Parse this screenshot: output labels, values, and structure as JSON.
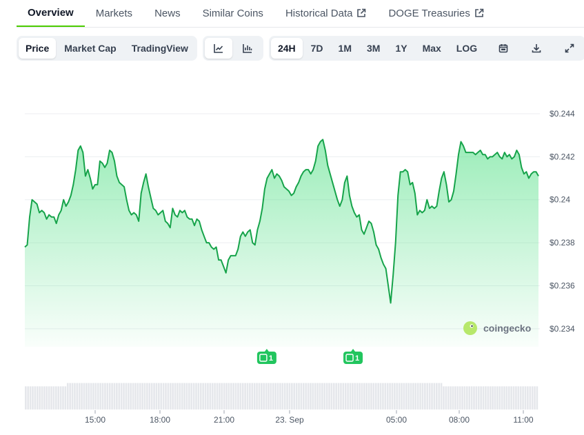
{
  "tabs": [
    {
      "label": "Overview",
      "active": true,
      "external": false
    },
    {
      "label": "Markets",
      "active": false,
      "external": false
    },
    {
      "label": "News",
      "active": false,
      "external": false
    },
    {
      "label": "Similar Coins",
      "active": false,
      "external": false
    },
    {
      "label": "Historical Data",
      "active": false,
      "external": true
    },
    {
      "label": "DOGE Treasuries",
      "active": false,
      "external": true
    }
  ],
  "toolbar": {
    "metric_buttons": [
      {
        "label": "Price",
        "selected": true
      },
      {
        "label": "Market Cap",
        "selected": false
      },
      {
        "label": "TradingView",
        "selected": false
      }
    ],
    "chart_type_icons": [
      {
        "icon": "line-chart-icon",
        "selected": true
      },
      {
        "icon": "candlestick-chart-icon",
        "selected": false
      }
    ],
    "range_buttons": [
      {
        "label": "24H",
        "selected": true
      },
      {
        "label": "7D",
        "selected": false
      },
      {
        "label": "1M",
        "selected": false
      },
      {
        "label": "3M",
        "selected": false
      },
      {
        "label": "1Y",
        "selected": false
      },
      {
        "label": "Max",
        "selected": false
      },
      {
        "label": "LOG",
        "selected": false
      }
    ],
    "action_icons": [
      "calendar-icon",
      "download-icon",
      "fullscreen-icon"
    ]
  },
  "watermark": "coingecko",
  "colors": {
    "line": "#16a34a",
    "area": "#4ade80",
    "accent": "#4bcc00",
    "volume": "#e5e7eb",
    "event": "#22c55e"
  },
  "chart_data": {
    "type": "area",
    "series": [
      {
        "values": [
          0.2378,
          0.2379,
          0.2392,
          0.24,
          0.2399,
          0.2398,
          0.2394,
          0.2395,
          0.2394,
          0.2391,
          0.2393,
          0.2392,
          0.2392,
          0.2389,
          0.2393,
          0.2395,
          0.24,
          0.2397,
          0.2399,
          0.2402,
          0.2407,
          0.2414,
          0.2423,
          0.2425,
          0.2422,
          0.2411,
          0.2414,
          0.241,
          0.2405,
          0.2407,
          0.2407,
          0.2418,
          0.2417,
          0.2415,
          0.2417,
          0.2423,
          0.2422,
          0.2418,
          0.2411,
          0.2408,
          0.2407,
          0.2406,
          0.24,
          0.2395,
          0.2393,
          0.2394,
          0.2393,
          0.239,
          0.2403,
          0.2408,
          0.2412,
          0.2406,
          0.2401,
          0.2396,
          0.2395,
          0.2393,
          0.2394,
          0.2395,
          0.239,
          0.2389,
          0.2387,
          0.2396,
          0.2393,
          0.2392,
          0.2395,
          0.2394,
          0.2395,
          0.2392,
          0.2391,
          0.2391,
          0.2388,
          0.2391,
          0.239,
          0.2386,
          0.2383,
          0.238,
          0.238,
          0.2378,
          0.2377,
          0.2378,
          0.2372,
          0.2372,
          0.2369,
          0.2366,
          0.2372,
          0.2374,
          0.2374,
          0.2374,
          0.2377,
          0.2383,
          0.2385,
          0.2383,
          0.2385,
          0.2386,
          0.238,
          0.2379,
          0.2386,
          0.239,
          0.2396,
          0.2405,
          0.241,
          0.2412,
          0.2414,
          0.241,
          0.2412,
          0.2411,
          0.2409,
          0.2406,
          0.2405,
          0.2404,
          0.2402,
          0.2403,
          0.2406,
          0.2408,
          0.2411,
          0.2413,
          0.2414,
          0.2414,
          0.2412,
          0.2414,
          0.2418,
          0.2425,
          0.2427,
          0.2428,
          0.2423,
          0.2416,
          0.2412,
          0.2408,
          0.2404,
          0.24,
          0.2397,
          0.24,
          0.2408,
          0.2411,
          0.2402,
          0.2397,
          0.2394,
          0.2392,
          0.2393,
          0.2386,
          0.2384,
          0.2387,
          0.239,
          0.2389,
          0.2385,
          0.2379,
          0.2377,
          0.2373,
          0.237,
          0.2368,
          0.236,
          0.2352,
          0.2365,
          0.238,
          0.2402,
          0.2413,
          0.2413,
          0.2414,
          0.2413,
          0.2407,
          0.2408,
          0.2403,
          0.2393,
          0.2395,
          0.2394,
          0.2395,
          0.24,
          0.2396,
          0.2397,
          0.2396,
          0.2397,
          0.2404,
          0.241,
          0.2413,
          0.2407,
          0.2399,
          0.24,
          0.2404,
          0.2412,
          0.2421,
          0.2427,
          0.2425,
          0.2422,
          0.2422,
          0.2422,
          0.2422,
          0.2421,
          0.2422,
          0.2423,
          0.2421,
          0.2421,
          0.2419,
          0.242,
          0.242,
          0.2421,
          0.2422,
          0.242,
          0.2419,
          0.2422,
          0.242,
          0.2421,
          0.2419,
          0.242,
          0.2423,
          0.2421,
          0.2415,
          0.2412,
          0.2413,
          0.241,
          0.2412,
          0.2413,
          0.2413,
          0.2411
        ]
      }
    ],
    "x_ticks": [
      "15:00",
      "18:00",
      "21:00",
      "23. Sep",
      "05:00",
      "08:00",
      "11:00"
    ],
    "y_ticks": [
      "$0.234",
      "$0.236",
      "$0.238",
      "$0.24",
      "$0.242",
      "$0.244"
    ],
    "y_tick_values": [
      0.234,
      0.236,
      0.238,
      0.24,
      0.242,
      0.244
    ],
    "ylim": [
      0.2331,
      0.2448
    ],
    "grid": true,
    "events": [
      {
        "count": "1",
        "at_fraction": 0.471
      },
      {
        "count": "1",
        "at_fraction": 0.639
      }
    ],
    "volume": [
      7,
      7,
      7,
      7,
      7,
      7,
      7,
      7,
      7,
      7,
      7,
      7,
      7,
      7,
      7,
      7,
      7,
      7,
      8,
      8,
      8,
      8,
      8,
      8,
      8,
      8,
      8,
      8,
      8,
      8,
      8,
      8,
      8,
      8,
      8,
      8,
      8,
      8,
      8,
      8,
      8,
      8,
      8,
      8,
      8,
      8,
      8,
      8,
      8,
      8,
      8,
      8,
      8,
      8,
      8,
      8,
      8,
      8,
      8,
      8,
      8,
      8,
      8,
      8,
      8,
      8,
      8,
      8,
      8,
      8,
      8,
      8,
      8,
      8,
      8,
      8,
      8,
      8,
      8,
      8,
      8,
      8,
      8,
      8,
      8,
      8,
      8,
      8,
      8,
      8,
      8,
      8,
      8,
      8,
      8,
      8,
      8,
      8,
      8,
      8,
      8,
      8,
      8,
      8,
      8,
      8,
      8,
      8,
      8,
      8,
      8,
      8,
      8,
      8,
      8,
      8,
      8,
      8,
      8,
      8,
      8,
      8,
      8,
      8,
      8,
      8,
      8,
      8,
      8,
      8,
      8,
      8,
      8,
      8,
      8,
      8,
      8,
      8,
      8,
      8,
      8,
      8,
      8,
      8,
      8,
      8,
      8,
      8,
      8,
      8,
      8,
      8,
      8,
      8,
      8,
      8,
      8,
      8,
      8,
      8,
      8,
      8,
      8,
      8,
      8,
      8,
      8,
      8,
      8,
      8,
      8,
      8,
      8,
      8,
      8,
      8,
      8,
      8,
      8,
      7,
      7,
      7,
      7,
      7,
      7,
      7,
      7,
      7,
      7,
      7,
      7,
      7,
      7,
      7,
      7,
      7,
      7,
      7,
      7,
      7,
      7,
      7,
      7,
      7,
      7,
      7,
      7,
      7,
      7,
      7,
      7,
      7,
      7,
      7,
      7,
      7,
      7,
      7,
      7,
      7
    ]
  }
}
